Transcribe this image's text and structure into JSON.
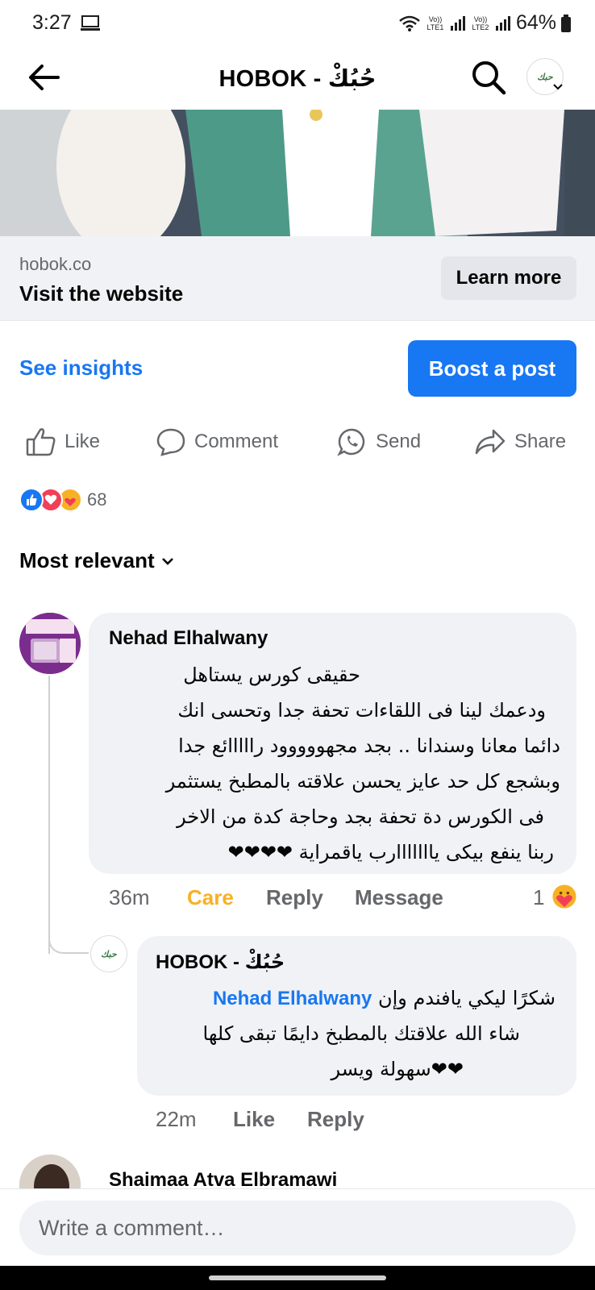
{
  "status_bar": {
    "time": "3:27",
    "sim1": "Vo)) LTE1",
    "sim2": "Vo)) LTE2",
    "battery": "64%"
  },
  "header": {
    "title": "HOBOK - حُبُكْ",
    "brand_logo_text": "حبك"
  },
  "link_card": {
    "domain": "hobok.co",
    "title": "Visit the website",
    "cta": "Learn more"
  },
  "post_actions": {
    "see_insights": "See insights",
    "boost": "Boost a post",
    "like": "Like",
    "comment": "Comment",
    "send": "Send",
    "share": "Share"
  },
  "reactions": {
    "count": "68",
    "icons": [
      "like-reaction-icon",
      "love-reaction-icon",
      "care-reaction-icon"
    ]
  },
  "sort": {
    "label": "Most relevant"
  },
  "comments": [
    {
      "author": "Nehad Elhalwany",
      "lines": [
        "حقيقى كورس يستاهل",
        "ودعمك لينا فى اللقاءات تحفة جدا وتحسى انك",
        "دائما معانا وسندانا .. بجد مجهووووود رااااائع جدا",
        "وبشجع كل حد عايز يحسن علاقته بالمطبخ يستثمر",
        "فى الكورس دة تحفة بجد وحاجة كدة من الاخر",
        "ربنا ينفع بيكى يااااااارب ياقمراية ❤❤❤❤"
      ],
      "time": "36m",
      "reaction_label": "Care",
      "reply": "Reply",
      "message": "Message",
      "reaction_count": "1"
    },
    {
      "author": "HOBOK - حُبُكْ",
      "mention": "Nehad Elhalwany",
      "lines": [
        "شكرًا ليكي يافندم وإن",
        "شاء الله علاقتك بالمطبخ دايمًا تبقى كلها",
        "❤❤سهولة ويسر"
      ],
      "time": "22m",
      "like": "Like",
      "reply": "Reply"
    },
    {
      "author": "Shaimaa Atva Elbramawi"
    }
  ],
  "composer": {
    "placeholder": "Write a comment…"
  },
  "colors": {
    "accent": "#1877f2",
    "care": "#f7b125",
    "bubble": "#f0f2f5",
    "secondary_text": "#65676b"
  }
}
